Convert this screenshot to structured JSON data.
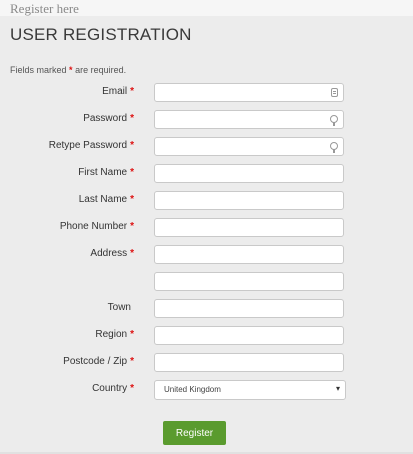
{
  "header": {
    "register_here": "Register here",
    "title": "USER REGISTRATION",
    "required_note_prefix": "Fields marked",
    "required_note_star": "*",
    "required_note_suffix": "are required."
  },
  "form": {
    "fields": [
      {
        "label": "Email",
        "required": "*",
        "value": "",
        "icon": "email-icon"
      },
      {
        "label": "Password",
        "required": "*",
        "value": "",
        "icon": "key-icon"
      },
      {
        "label": "Retype Password",
        "required": "*",
        "value": "",
        "icon": "key-icon"
      },
      {
        "label": "First Name",
        "required": "*",
        "value": ""
      },
      {
        "label": "Last Name",
        "required": "*",
        "value": ""
      },
      {
        "label": "Phone Number",
        "required": "*",
        "value": ""
      },
      {
        "label": "Address",
        "required": "*",
        "value": ""
      },
      {
        "label": "",
        "required": "",
        "value": ""
      },
      {
        "label": "Town",
        "required": "",
        "value": ""
      },
      {
        "label": "Region",
        "required": "*",
        "value": ""
      },
      {
        "label": "Postcode / Zip",
        "required": "*",
        "value": ""
      }
    ],
    "country": {
      "label": "Country",
      "required": "*",
      "selected": "United Kingdom",
      "arrow": "▾"
    },
    "submit_label": "Register"
  },
  "colors": {
    "accent": "#5a9b2e",
    "required": "#dd1111",
    "background": "#ececec"
  }
}
